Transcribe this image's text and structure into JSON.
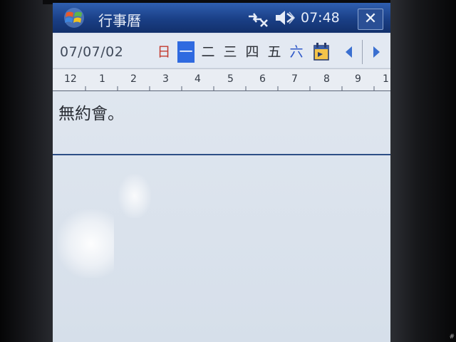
{
  "titlebar": {
    "app_title": "行事曆",
    "clock": "07:48",
    "close_label": "✕",
    "start_icon": "windows-flag-icon",
    "connectivity_icon": "connectivity-off-icon",
    "volume_icon": "speaker-mute-icon"
  },
  "weekbar": {
    "date": "07/07/02",
    "days": [
      {
        "label": "日",
        "kind": "sun"
      },
      {
        "label": "一",
        "kind": "sel"
      },
      {
        "label": "二",
        "kind": ""
      },
      {
        "label": "三",
        "kind": ""
      },
      {
        "label": "四",
        "kind": ""
      },
      {
        "label": "五",
        "kind": ""
      },
      {
        "label": "六",
        "kind": "sat"
      }
    ],
    "selected_index": 1,
    "today_icon": "go-to-today-icon",
    "prev_icon": "arrow-left-icon",
    "next_icon": "arrow-right-icon"
  },
  "hours": [
    "12",
    "1",
    "2",
    "3",
    "4",
    "5",
    "6",
    "7",
    "8",
    "9",
    "1"
  ],
  "day_body": {
    "message": "無約會。"
  },
  "colors": {
    "titlebar": "#1a3f86",
    "selection": "#2f6ae0",
    "sunday": "#c33a2e",
    "saturday": "#2f58c8"
  }
}
